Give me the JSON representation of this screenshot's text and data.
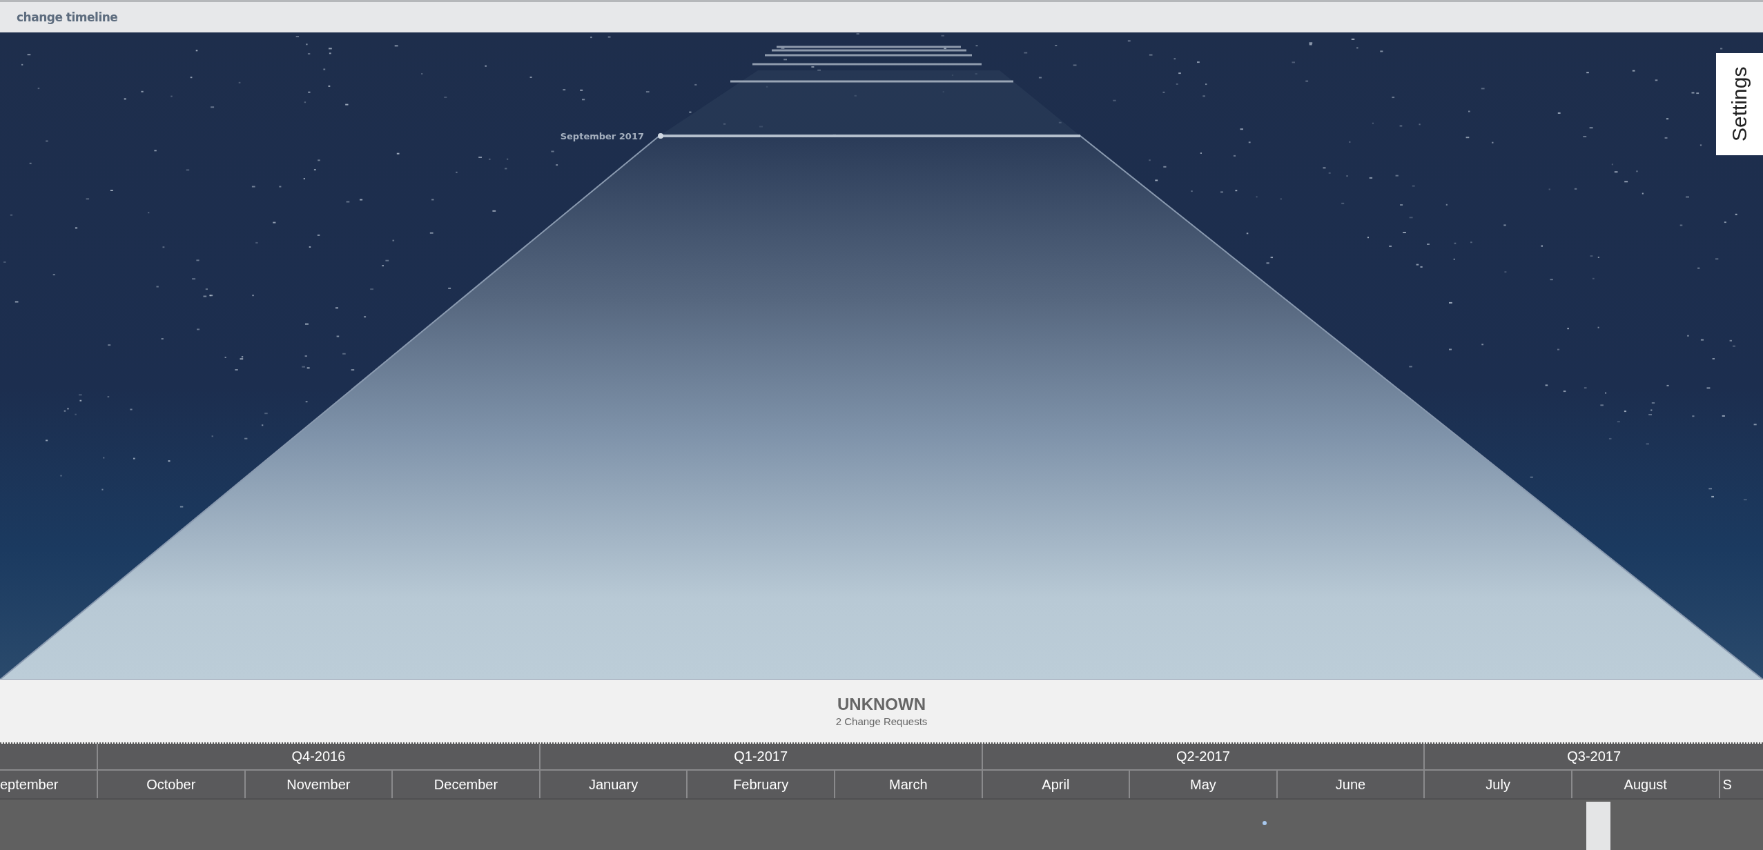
{
  "header": {
    "title": "change timeline"
  },
  "scene": {
    "markers": [
      {
        "label": "September 2017"
      }
    ]
  },
  "settings_tab": {
    "label": "Settings"
  },
  "info": {
    "title": "UNKNOWN",
    "subtitle": "2 Change Requests"
  },
  "timeline": {
    "quarters": [
      "Q4-2016",
      "Q1-2017",
      "Q2-2017",
      "Q3-2017"
    ],
    "months": [
      "eptember",
      "October",
      "November",
      "December",
      "January",
      "February",
      "March",
      "April",
      "May",
      "June",
      "July",
      "August",
      "S"
    ]
  }
}
